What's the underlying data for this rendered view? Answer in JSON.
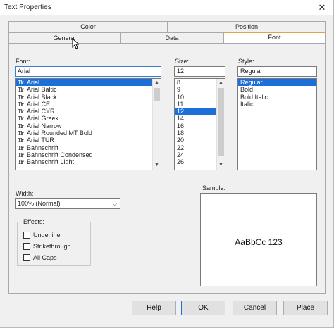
{
  "window": {
    "title": "Text Properties",
    "close_glyph": "✕"
  },
  "tabs": {
    "back": [
      {
        "label": "Color"
      },
      {
        "label": "Position"
      }
    ],
    "front": [
      {
        "label": "General"
      },
      {
        "label": "Data"
      },
      {
        "label": "Font",
        "active": true
      }
    ]
  },
  "font": {
    "label": "Font:",
    "value": "Arial",
    "items": [
      "Arial",
      "Arial Baltic",
      "Arial Black",
      "Arial CE",
      "Arial CYR",
      "Arial Greek",
      "Arial Narrow",
      "Arial Rounded MT Bold",
      "Arial TUR",
      "Bahnschrift",
      "Bahnschrift Condensed",
      "Bahnschrift Light"
    ],
    "selected": "Arial"
  },
  "size": {
    "label": "Size:",
    "value": "12",
    "items": [
      "8",
      "9",
      "10",
      "11",
      "12",
      "14",
      "16",
      "18",
      "20",
      "22",
      "24",
      "26"
    ]
  },
  "style": {
    "label": "Style:",
    "value": "Regular",
    "items": [
      "Regular",
      "Bold",
      "Bold Italic",
      "Italic"
    ],
    "selected": "Regular"
  },
  "width": {
    "label": "Width:",
    "value": "100% (Normal)"
  },
  "effects": {
    "title": "Effects:",
    "items": [
      {
        "label": "Underline",
        "checked": false
      },
      {
        "label": "Strikethrough",
        "checked": false
      },
      {
        "label": "All Caps",
        "checked": false
      }
    ]
  },
  "sample": {
    "title": "Sample:",
    "text": "AaBbCc 123"
  },
  "buttons": {
    "help": "Help",
    "ok": "OK",
    "cancel": "Cancel",
    "place": "Place"
  },
  "icons": {
    "font_type": "truetype-font-icon",
    "scroll_up": "chevron-up-icon",
    "scroll_down": "chevron-down-icon",
    "dropdown": "chevron-down-icon",
    "cursor": "mouse-pointer-icon"
  },
  "colors": {
    "accent": "#1c6fd8",
    "active_tab_marker": "#e8a040"
  }
}
